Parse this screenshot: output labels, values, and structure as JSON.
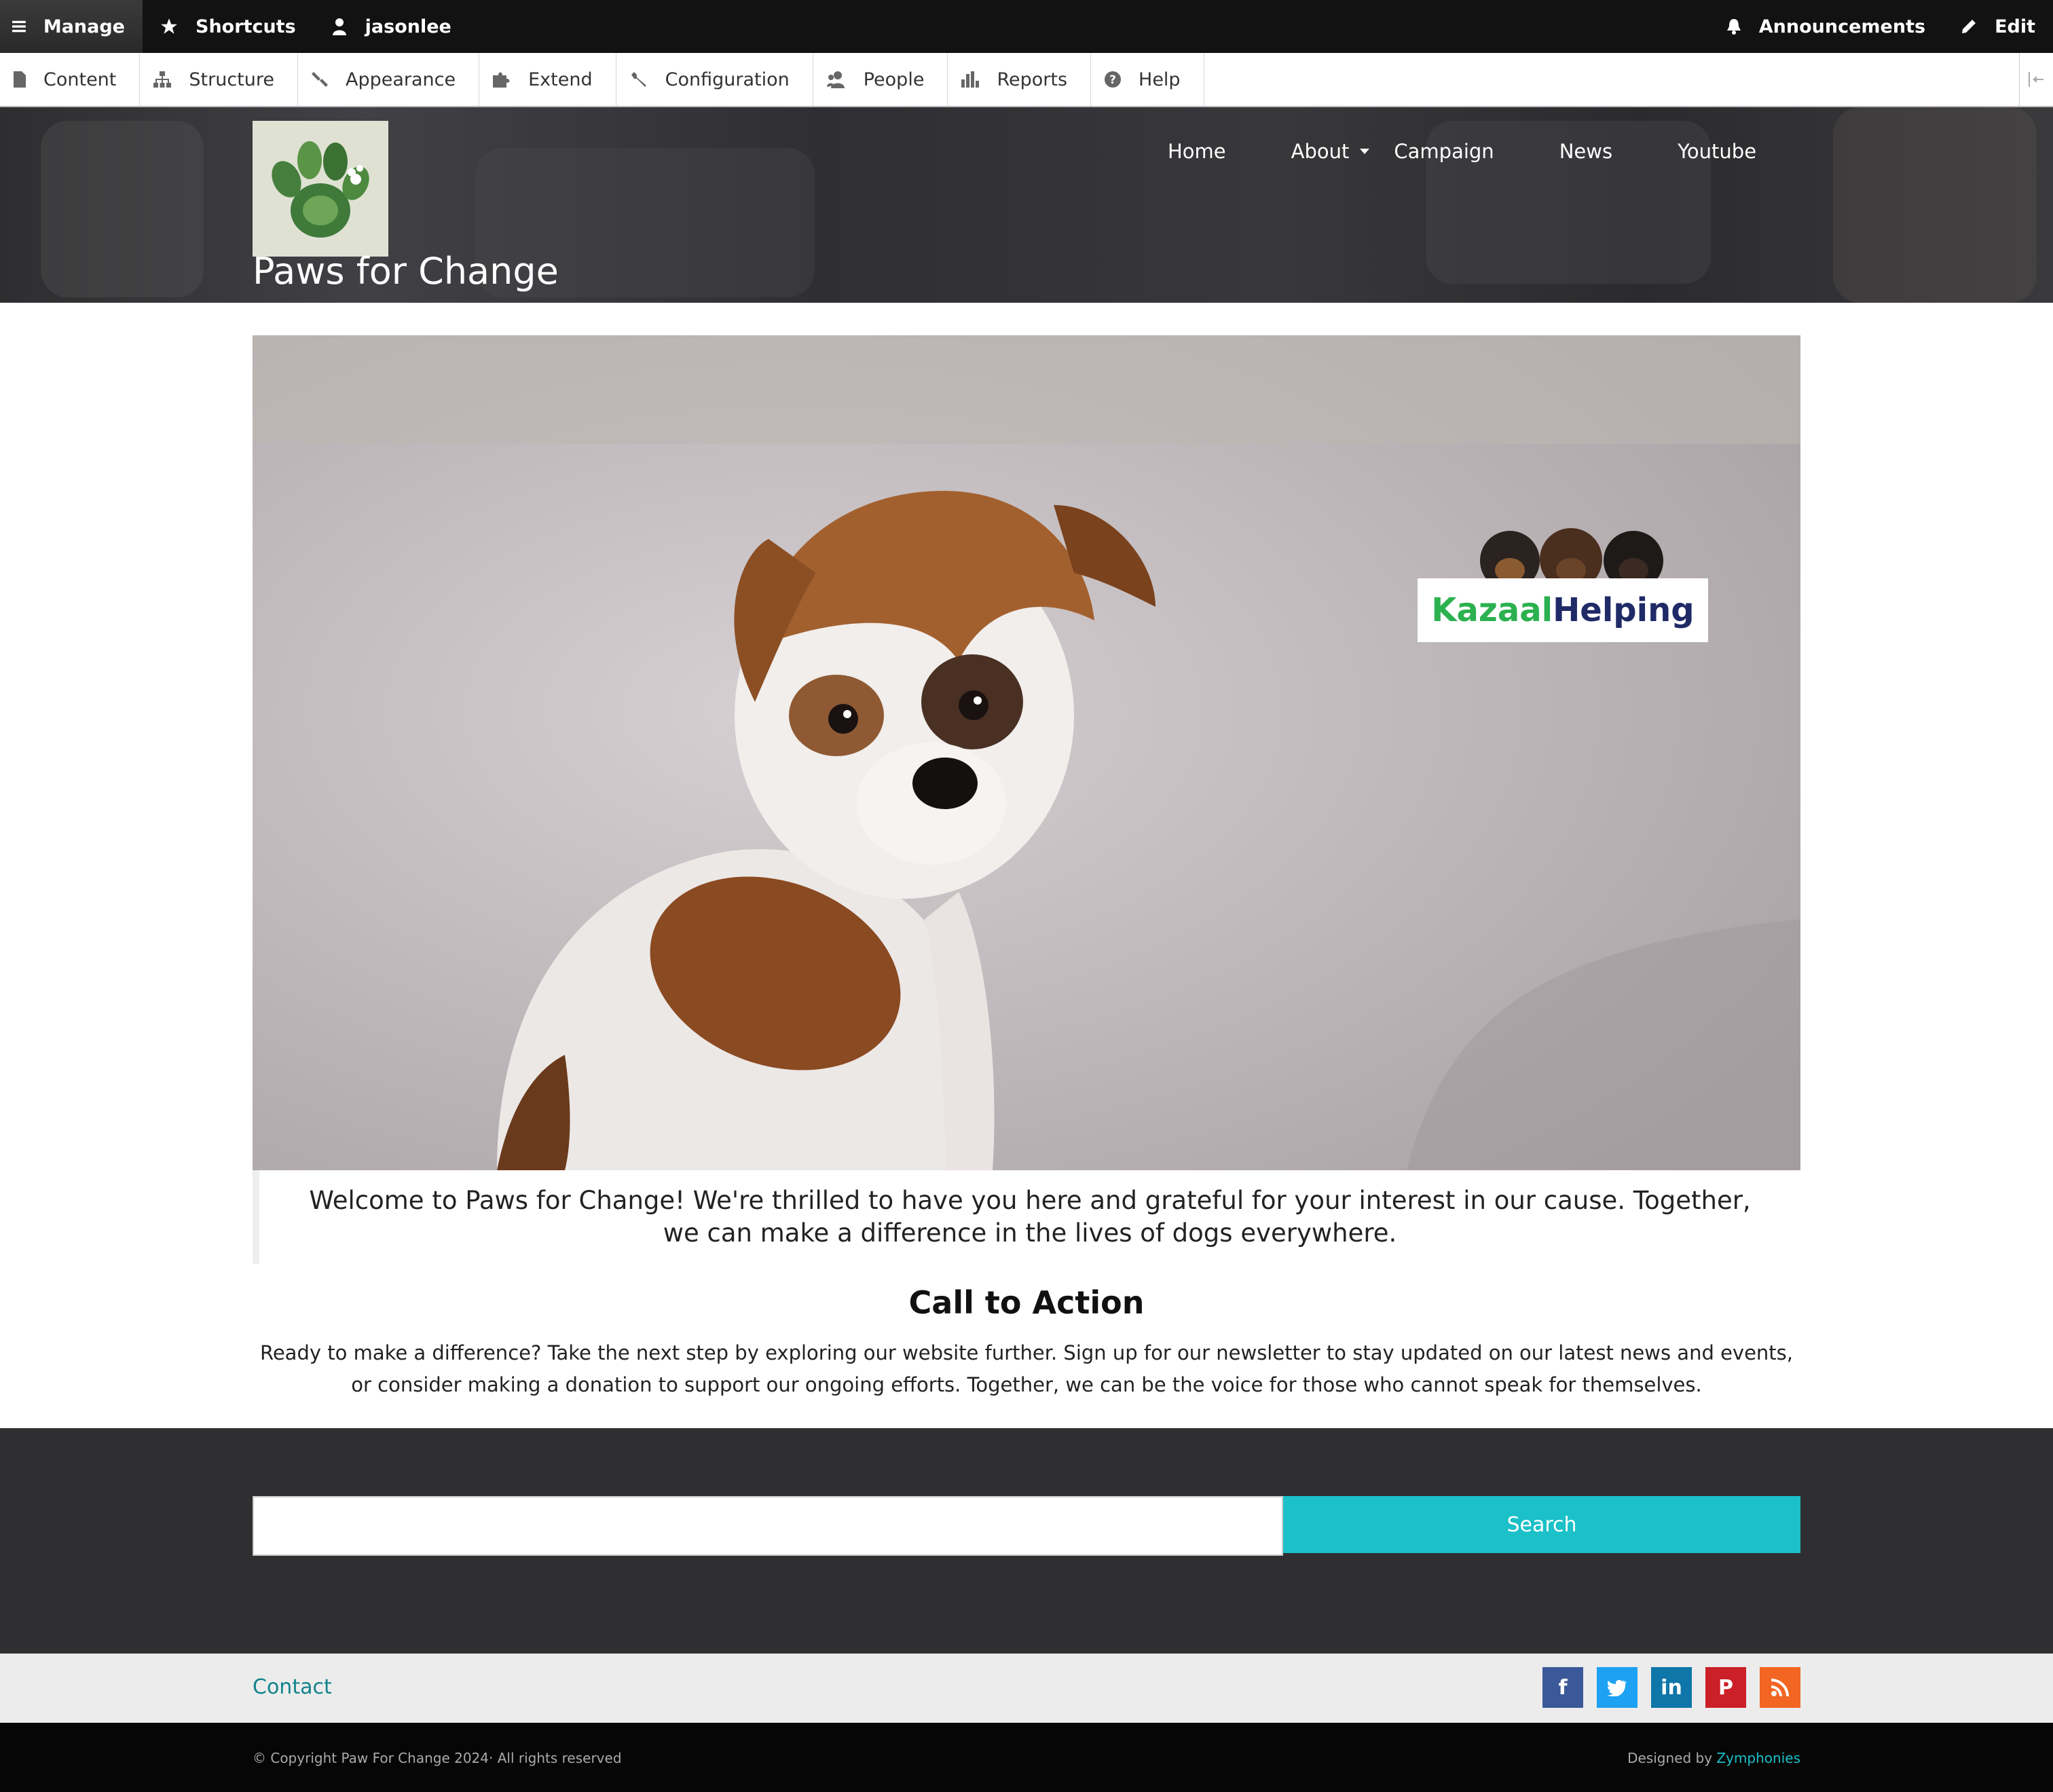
{
  "admin_bar": {
    "manage": "Manage",
    "shortcuts": "Shortcuts",
    "user": "jasonlee",
    "announcements": "Announcements",
    "edit": "Edit"
  },
  "admin_tray": {
    "items": [
      {
        "label": "Content",
        "icon": "file-icon"
      },
      {
        "label": "Structure",
        "icon": "sitemap-icon"
      },
      {
        "label": "Appearance",
        "icon": "brush-icon"
      },
      {
        "label": "Extend",
        "icon": "puzzle-icon"
      },
      {
        "label": "Configuration",
        "icon": "wrench-icon"
      },
      {
        "label": "People",
        "icon": "people-icon"
      },
      {
        "label": "Reports",
        "icon": "bar-chart-icon"
      },
      {
        "label": "Help",
        "icon": "help-icon"
      }
    ]
  },
  "site": {
    "name": "Paws for Change",
    "nav": {
      "home": "Home",
      "about": "About",
      "campaign": "Campaign",
      "news": "News",
      "youtube": "Youtube"
    }
  },
  "hero": {
    "badge_part1": "Kazaal",
    "badge_part2": "Helping"
  },
  "welcome": {
    "text": "Welcome to Paws for Change! We're thrilled to have you here and grateful for your interest in our cause. Together, we can make a difference in the lives of dogs everywhere."
  },
  "cta": {
    "title": "Call to Action",
    "text": "Ready to make a difference? Take the next step by exploring our website further. Sign up for our newsletter to stay updated on our latest news and events, or consider making a donation to support our ongoing efforts. Together, we can be the voice for those who cannot speak for themselves."
  },
  "footer": {
    "search_button": "Search",
    "search_value": "",
    "contact": "Contact",
    "social": [
      {
        "label": "f",
        "icon": "facebook-icon",
        "color": "#3b5998"
      },
      {
        "label": "t",
        "icon": "twitter-icon",
        "color": "#1da1f2"
      },
      {
        "label": "in",
        "icon": "linkedin-icon",
        "color": "#0e76a8"
      },
      {
        "label": "P",
        "icon": "pinterest-icon",
        "color": "#cb2027"
      },
      {
        "label": "rss",
        "icon": "rss-icon",
        "color": "#f26522"
      }
    ],
    "copyright": "© Copyright Paw For Change 2024· All rights reserved",
    "designed_by": "Designed by",
    "designer": "Zymphonies"
  },
  "colors": {
    "accent": "#1bc0c8",
    "link": "#13838d",
    "admin_bar": "#121212",
    "footer_dark": "#2f2f31"
  }
}
